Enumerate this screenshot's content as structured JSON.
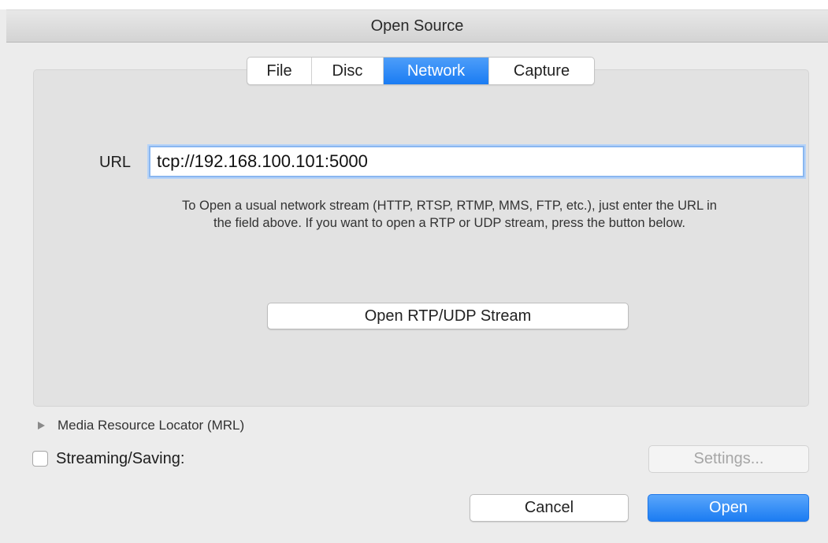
{
  "window": {
    "title": "Open Source"
  },
  "tabs": [
    {
      "label": "File",
      "selected": false
    },
    {
      "label": "Disc",
      "selected": false
    },
    {
      "label": "Network",
      "selected": true
    },
    {
      "label": "Capture",
      "selected": false
    }
  ],
  "network": {
    "url_label": "URL",
    "url_value": "tcp://192.168.100.101:5000",
    "help_line1": "To Open a usual network stream (HTTP, RTSP, RTMP, MMS, FTP, etc.), just enter the URL in",
    "help_line2": "the field above. If you want to open a RTP or UDP stream, press the button below.",
    "rtp_button_label": "Open RTP/UDP Stream"
  },
  "mrl": {
    "label": "Media Resource Locator (MRL)",
    "expanded": false,
    "disclosure_icon": "triangle-right-icon"
  },
  "streaming": {
    "label": "Streaming/Saving:",
    "checked": false,
    "settings_label": "Settings...",
    "settings_enabled": false
  },
  "actions": {
    "cancel_label": "Cancel",
    "open_label": "Open"
  },
  "colors": {
    "accent": "#1a7cf3",
    "background": "#ececec",
    "panel": "#e2e2e2"
  }
}
